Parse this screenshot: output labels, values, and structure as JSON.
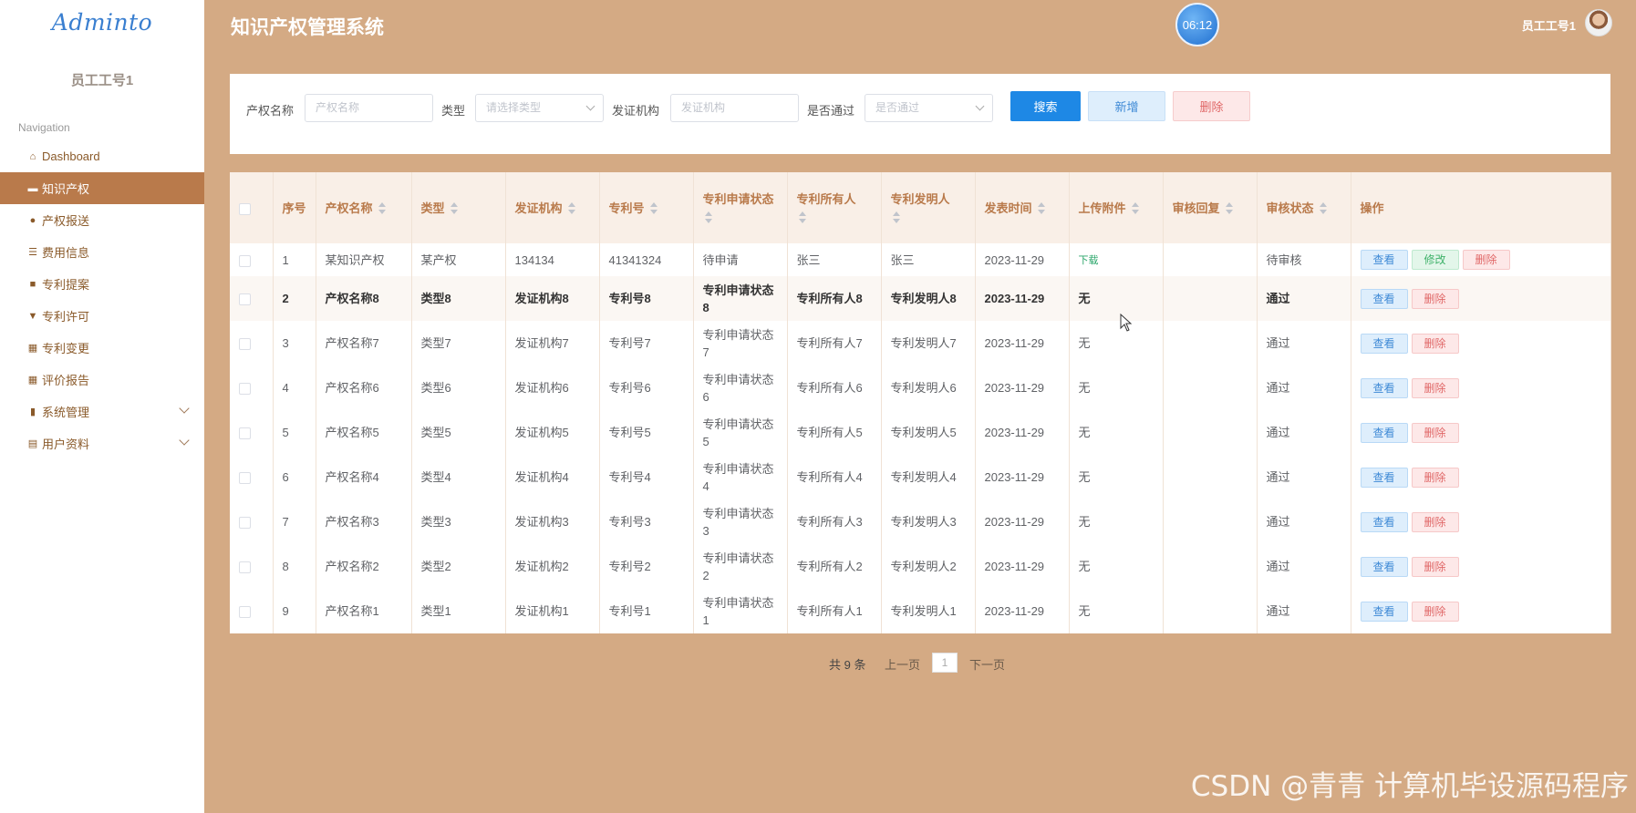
{
  "sidebar": {
    "logo": "Adminto",
    "user": "员工工号1",
    "nav_title": "Navigation",
    "items": [
      {
        "label": "Dashboard"
      },
      {
        "label": "知识产权"
      },
      {
        "label": "产权报送"
      },
      {
        "label": "费用信息"
      },
      {
        "label": "专利提案"
      },
      {
        "label": "专利许可"
      },
      {
        "label": "专利变更"
      },
      {
        "label": "评价报告"
      },
      {
        "label": "系统管理"
      },
      {
        "label": "用户资料"
      }
    ]
  },
  "header": {
    "title": "知识产权管理系统",
    "clock": "06:12",
    "user": "员工工号1"
  },
  "search": {
    "name_label": "产权名称",
    "name_placeholder": "产权名称",
    "type_label": "类型",
    "type_placeholder": "请选择类型",
    "org_label": "发证机构",
    "org_placeholder": "发证机构",
    "pass_label": "是否通过",
    "pass_placeholder": "是否通过",
    "btn_search": "搜索",
    "btn_add": "新增",
    "btn_delete": "删除"
  },
  "table": {
    "columns": [
      "序号",
      "产权名称",
      "类型",
      "发证机构",
      "专利号",
      "专利申请状态",
      "专利所有人",
      "专利发明人",
      "发表时间",
      "上传附件",
      "审核回复",
      "审核状态",
      "操作"
    ],
    "rows": [
      {
        "no": "1",
        "name": "某知识产权",
        "type": "某产权",
        "org": "134134",
        "patent": "41341324",
        "status": "待申请",
        "owner": "张三",
        "inventor": "张三",
        "date": "2023-11-29",
        "attach": "下载",
        "reply": "",
        "review": "待审核"
      },
      {
        "no": "2",
        "name": "产权名称8",
        "type": "类型8",
        "org": "发证机构8",
        "patent": "专利号8",
        "status": "专利申请状态8",
        "owner": "专利所有人8",
        "inventor": "专利发明人8",
        "date": "2023-11-29",
        "attach": "无",
        "reply": "",
        "review": "通过"
      },
      {
        "no": "3",
        "name": "产权名称7",
        "type": "类型7",
        "org": "发证机构7",
        "patent": "专利号7",
        "status": "专利申请状态7",
        "owner": "专利所有人7",
        "inventor": "专利发明人7",
        "date": "2023-11-29",
        "attach": "无",
        "reply": "",
        "review": "通过"
      },
      {
        "no": "4",
        "name": "产权名称6",
        "type": "类型6",
        "org": "发证机构6",
        "patent": "专利号6",
        "status": "专利申请状态6",
        "owner": "专利所有人6",
        "inventor": "专利发明人6",
        "date": "2023-11-29",
        "attach": "无",
        "reply": "",
        "review": "通过"
      },
      {
        "no": "5",
        "name": "产权名称5",
        "type": "类型5",
        "org": "发证机构5",
        "patent": "专利号5",
        "status": "专利申请状态5",
        "owner": "专利所有人5",
        "inventor": "专利发明人5",
        "date": "2023-11-29",
        "attach": "无",
        "reply": "",
        "review": "通过"
      },
      {
        "no": "6",
        "name": "产权名称4",
        "type": "类型4",
        "org": "发证机构4",
        "patent": "专利号4",
        "status": "专利申请状态4",
        "owner": "专利所有人4",
        "inventor": "专利发明人4",
        "date": "2023-11-29",
        "attach": "无",
        "reply": "",
        "review": "通过"
      },
      {
        "no": "7",
        "name": "产权名称3",
        "type": "类型3",
        "org": "发证机构3",
        "patent": "专利号3",
        "status": "专利申请状态3",
        "owner": "专利所有人3",
        "inventor": "专利发明人3",
        "date": "2023-11-29",
        "attach": "无",
        "reply": "",
        "review": "通过"
      },
      {
        "no": "8",
        "name": "产权名称2",
        "type": "类型2",
        "org": "发证机构2",
        "patent": "专利号2",
        "status": "专利申请状态2",
        "owner": "专利所有人2",
        "inventor": "专利发明人2",
        "date": "2023-11-29",
        "attach": "无",
        "reply": "",
        "review": "通过"
      },
      {
        "no": "9",
        "name": "产权名称1",
        "type": "类型1",
        "org": "发证机构1",
        "patent": "专利号1",
        "status": "专利申请状态1",
        "owner": "专利所有人1",
        "inventor": "专利发明人1",
        "date": "2023-11-29",
        "attach": "无",
        "reply": "",
        "review": "通过"
      }
    ],
    "actions": {
      "view": "查看",
      "edit": "修改",
      "delete": "删除"
    }
  },
  "pagination": {
    "total": "共 9 条",
    "prev": "上一页",
    "page": "1",
    "next": "下一页"
  },
  "watermark": "CSDN @青青  计算机毕设源码程序",
  "colors": {
    "background": "#d4aa84",
    "sidebar_active": "#b97a4b",
    "primary": "#1e88e5"
  }
}
